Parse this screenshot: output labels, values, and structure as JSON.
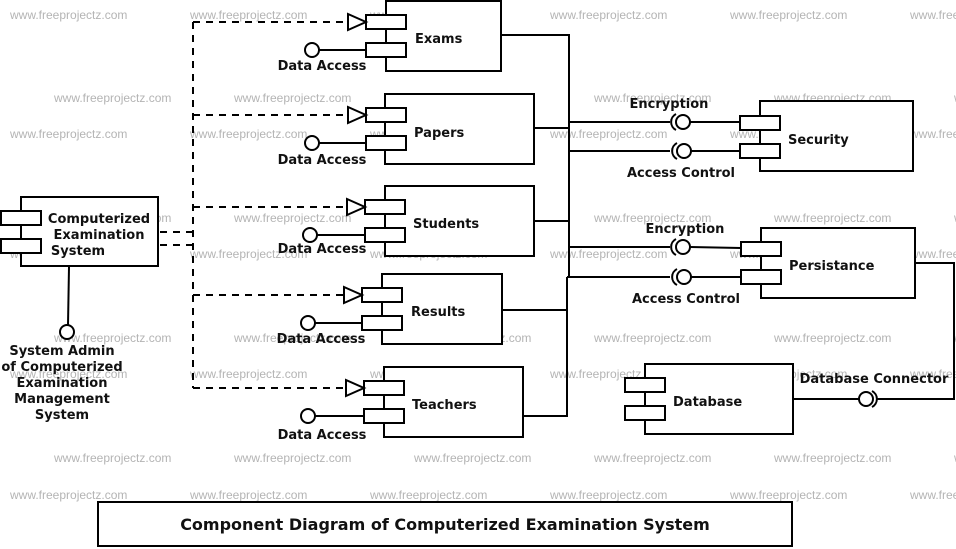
{
  "watermark": "www.freeprojectz.com",
  "title": "Component Diagram of Computerized Examination System",
  "main_component": {
    "label_lines": [
      "Computerized",
      "Examination",
      "System"
    ]
  },
  "actor": {
    "label_lines": [
      "System Admin",
      "of Computerized",
      "Examination",
      "Management",
      "System"
    ]
  },
  "components": [
    {
      "name": "Exams",
      "interface": "Data Access"
    },
    {
      "name": "Papers",
      "interface": "Data Access"
    },
    {
      "name": "Students",
      "interface": "Data Access"
    },
    {
      "name": "Results",
      "interface": "Data Access"
    },
    {
      "name": "Teachers",
      "interface": "Data Access"
    }
  ],
  "security": {
    "name": "Security",
    "interfaces": [
      "Encryption",
      "Access Control"
    ]
  },
  "persistance": {
    "name": "Persistance",
    "interfaces": [
      "Encryption",
      "Access Control"
    ]
  },
  "database": {
    "name": "Database",
    "interface": "Database Connector"
  }
}
